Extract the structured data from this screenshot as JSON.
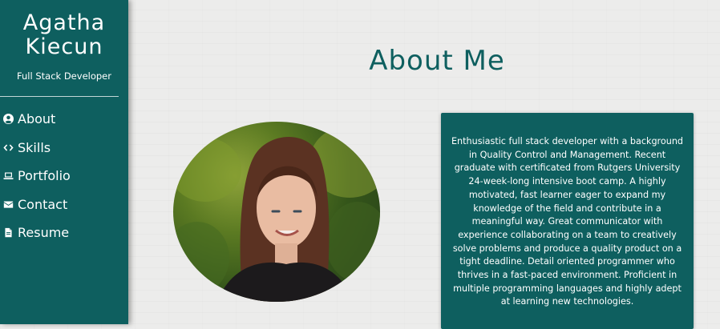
{
  "sidebar": {
    "name": "Agatha Kiecun",
    "role": "Full Stack Developer",
    "nav": [
      {
        "label": "About",
        "icon": "user-circle-icon"
      },
      {
        "label": "Skills",
        "icon": "code-icon"
      },
      {
        "label": "Portfolio",
        "icon": "laptop-icon"
      },
      {
        "label": "Contact",
        "icon": "envelope-icon"
      },
      {
        "label": "Resume",
        "icon": "file-icon"
      }
    ]
  },
  "main": {
    "title": "About Me",
    "bio": "Enthusiastic full stack developer with a background in Quality Control and Management. Recent graduate with certificated from Rutgers University 24-week-long intensive boot camp. A highly motivated, fast learner eager to expand my knowledge of the field and contribute in a meaningful way. Great communicator with experience collaborating on a team to creatively solve problems and produce a quality product on a tight deadline. Detail oriented programmer who thrives in a fast-paced environment. Proficient in multiple programming languages and highly adept at learning new technologies."
  },
  "colors": {
    "accent": "#0e5f5f",
    "background": "#ececeb"
  }
}
